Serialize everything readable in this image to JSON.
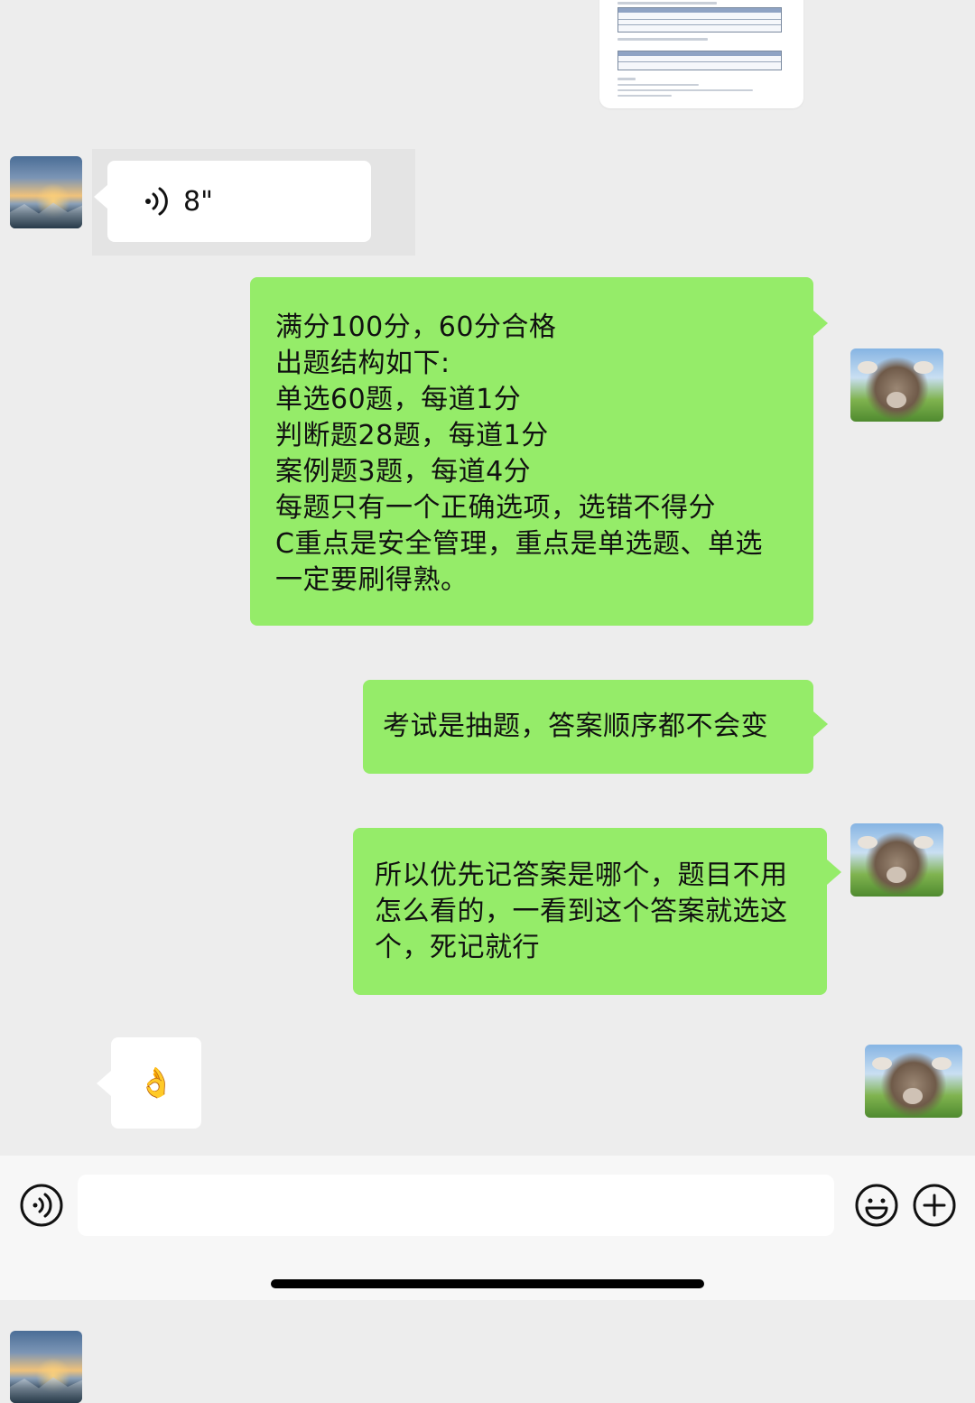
{
  "document_preview": {
    "icon": "document-thumbnail"
  },
  "messages": [
    {
      "side": "left",
      "type": "voice",
      "duration": "8\"",
      "avatar": "landscape-avatar"
    },
    {
      "side": "right",
      "type": "text",
      "avatar": "cow-avatar",
      "text": "满分100分，60分合格\n出题结构如下:\n单选60题，每道1分\n判断题28题，每道1分\n案例题3题，每道4分\n每题只有一个正确选项，选错不得分\nC重点是安全管理，重点是单选题、单选\n一定要刷得熟。"
    },
    {
      "side": "right",
      "type": "text",
      "avatar": "cow-avatar",
      "text": "考试是抽题，答案顺序都不会变"
    },
    {
      "side": "right",
      "type": "text",
      "avatar": "cow-avatar",
      "text": "所以优先记答案是哪个，题目不用\n怎么看的，一看到这个答案就选这\n个，死记就行"
    },
    {
      "side": "left",
      "type": "emoji",
      "avatar": "landscape-avatar",
      "emoji": "👌"
    }
  ],
  "input_bar": {
    "voice_icon": "voice-input-icon",
    "emoji_icon": "emoji-icon",
    "add_icon": "add-icon",
    "input_value": ""
  },
  "colors": {
    "background": "#ededed",
    "green_bubble": "#95ec69",
    "white_bubble": "#ffffff",
    "bottom_bar": "#f7f7f7"
  }
}
